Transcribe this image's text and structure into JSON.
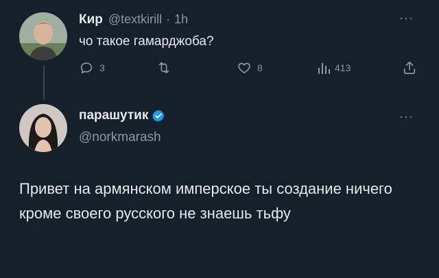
{
  "parent_tweet": {
    "display_name": "Кир",
    "handle": "@textkirill",
    "separator": "·",
    "time": "1h",
    "text": "чо такое гамарджоба?",
    "more_icon": "more-horizontal-icon",
    "actions": {
      "reply_count": "3",
      "retweet_count": "",
      "like_count": "8",
      "views_count": "413"
    }
  },
  "reply_tweet": {
    "display_name": "парашутик",
    "verified": true,
    "handle": "@norkmarash",
    "more_icon": "more-horizontal-icon",
    "text": "Привет на армянском имперское ты создание ничего кроме своего русского не знаешь тьфу"
  },
  "colors": {
    "background": "#15202b",
    "text": "#e7e9ea",
    "muted": "#8b98a5",
    "verified": "#1d9bf0"
  }
}
